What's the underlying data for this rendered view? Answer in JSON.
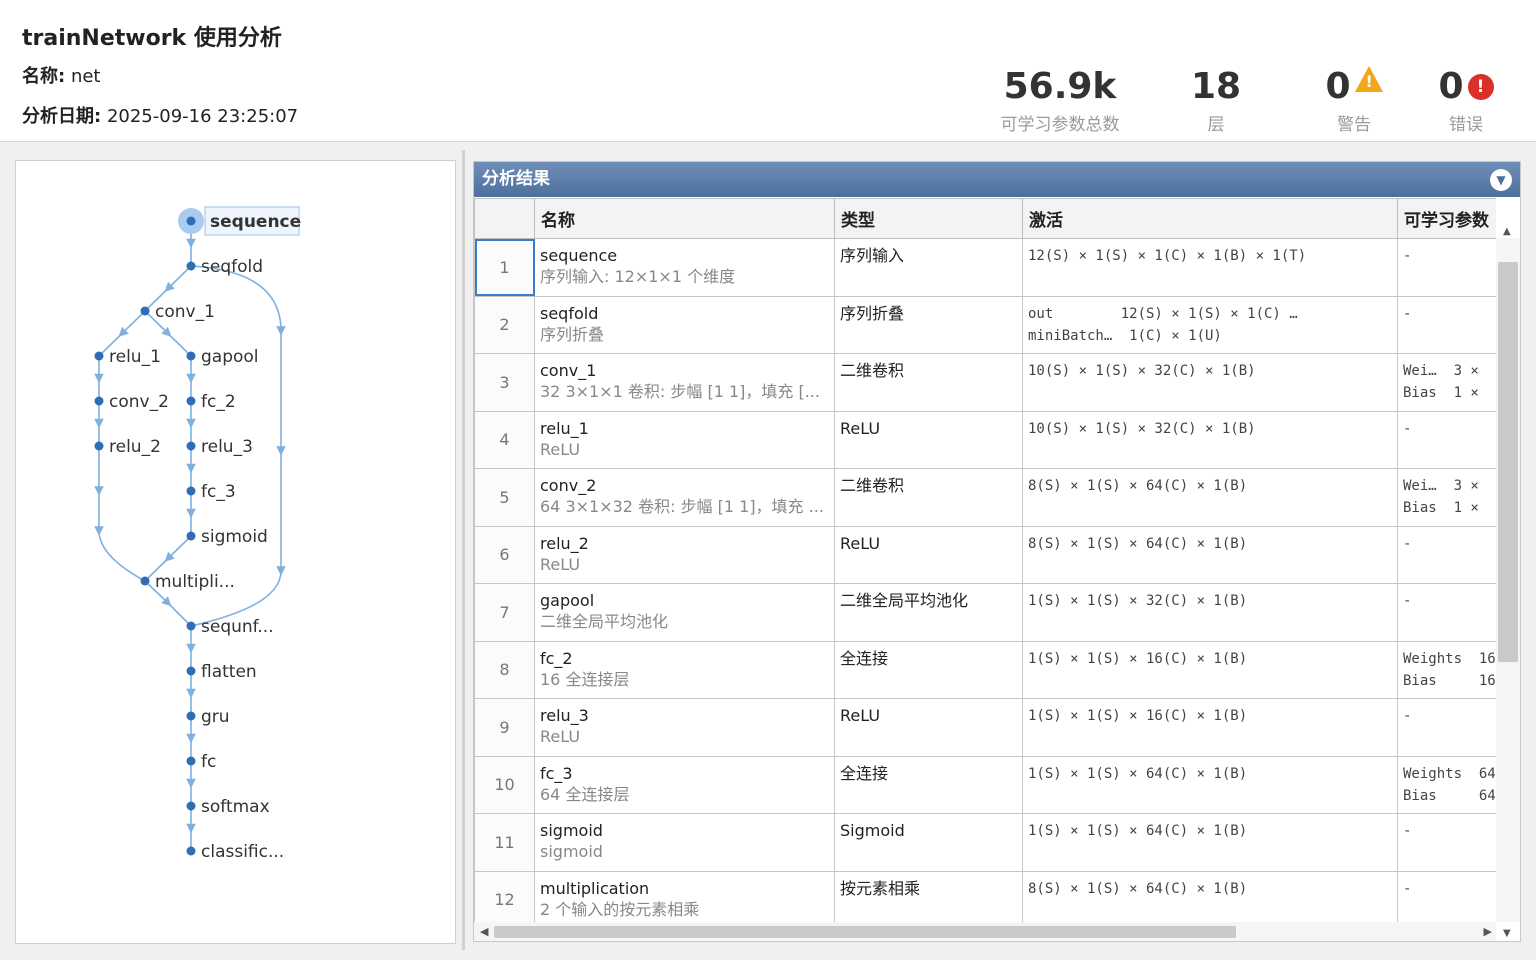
{
  "header": {
    "title": "trainNetwork 使用分析",
    "name_label": "名称:",
    "name_value": "net",
    "date_label": "分析日期:",
    "date_value": "2025-09-16 23:25:07"
  },
  "stats": {
    "params_value": "56.9k",
    "params_label": "可学习参数总数",
    "layers_value": "18",
    "layers_label": "层",
    "warnings_value": "0",
    "warnings_label": "警告",
    "errors_value": "0",
    "errors_label": "错误",
    "warning_icon": "warning-triangle-icon",
    "error_icon": "error-circle-icon"
  },
  "graph": {
    "nodes": [
      {
        "id": "sequence",
        "label": "sequence",
        "selected": true
      },
      {
        "id": "seqfold",
        "label": "seqfold"
      },
      {
        "id": "conv_1",
        "label": "conv_1"
      },
      {
        "id": "relu_1",
        "label": "relu_1"
      },
      {
        "id": "gapool",
        "label": "gapool"
      },
      {
        "id": "conv_2",
        "label": "conv_2"
      },
      {
        "id": "fc_2",
        "label": "fc_2"
      },
      {
        "id": "relu_2",
        "label": "relu_2"
      },
      {
        "id": "relu_3",
        "label": "relu_3"
      },
      {
        "id": "fc_3",
        "label": "fc_3"
      },
      {
        "id": "sigmoid",
        "label": "sigmoid"
      },
      {
        "id": "multiplication",
        "label": "multipli..."
      },
      {
        "id": "sequnfold",
        "label": "sequnf..."
      },
      {
        "id": "flatten",
        "label": "flatten"
      },
      {
        "id": "gru",
        "label": "gru"
      },
      {
        "id": "fc",
        "label": "fc"
      },
      {
        "id": "softmax",
        "label": "softmax"
      },
      {
        "id": "classification",
        "label": "classific..."
      }
    ]
  },
  "results": {
    "title": "分析结果",
    "columns": [
      "名称",
      "类型",
      "激活",
      "可学习参数"
    ],
    "rows": [
      {
        "idx": "1",
        "name": "sequence",
        "desc": "序列输入: 12×1×1 个维度",
        "type": "序列输入",
        "act1": "12(S) × 1(S) × 1(C) × 1(B) × 1(T)",
        "act2": "",
        "learn1": "-",
        "learn2": ""
      },
      {
        "idx": "2",
        "name": "seqfold",
        "desc": "序列折叠",
        "type": "序列折叠",
        "act1": "out        12(S) × 1(S) × 1(C) …",
        "act2": "miniBatch…  1(C) × 1(U)",
        "learn1": "-",
        "learn2": ""
      },
      {
        "idx": "3",
        "name": "conv_1",
        "desc": "32 3×1×1 卷积: 步幅 [1 1]，填充 [...",
        "type": "二维卷积",
        "act1": "10(S) × 1(S) × 32(C) × 1(B)",
        "act2": "",
        "learn1": "Wei…  3 ×",
        "learn2": "Bias  1 ×"
      },
      {
        "idx": "4",
        "name": "relu_1",
        "desc": "ReLU",
        "type": "ReLU",
        "act1": "10(S) × 1(S) × 32(C) × 1(B)",
        "act2": "",
        "learn1": "-",
        "learn2": ""
      },
      {
        "idx": "5",
        "name": "conv_2",
        "desc": "64 3×1×32 卷积: 步幅 [1 1]，填充 ...",
        "type": "二维卷积",
        "act1": "8(S) × 1(S) × 64(C) × 1(B)",
        "act2": "",
        "learn1": "Wei…  3 ×",
        "learn2": "Bias  1 ×"
      },
      {
        "idx": "6",
        "name": "relu_2",
        "desc": "ReLU",
        "type": "ReLU",
        "act1": "8(S) × 1(S) × 64(C) × 1(B)",
        "act2": "",
        "learn1": "-",
        "learn2": ""
      },
      {
        "idx": "7",
        "name": "gapool",
        "desc": "二维全局平均池化",
        "type": "二维全局平均池化",
        "act1": "1(S) × 1(S) × 32(C) × 1(B)",
        "act2": "",
        "learn1": "-",
        "learn2": ""
      },
      {
        "idx": "8",
        "name": "fc_2",
        "desc": "16 全连接层",
        "type": "全连接",
        "act1": "1(S) × 1(S) × 16(C) × 1(B)",
        "act2": "",
        "learn1": "Weights  16",
        "learn2": "Bias     16"
      },
      {
        "idx": "9",
        "name": "relu_3",
        "desc": "ReLU",
        "type": "ReLU",
        "act1": "1(S) × 1(S) × 16(C) × 1(B)",
        "act2": "",
        "learn1": "-",
        "learn2": ""
      },
      {
        "idx": "10",
        "name": "fc_3",
        "desc": "64 全连接层",
        "type": "全连接",
        "act1": "1(S) × 1(S) × 64(C) × 1(B)",
        "act2": "",
        "learn1": "Weights  64",
        "learn2": "Bias     64"
      },
      {
        "idx": "11",
        "name": "sigmoid",
        "desc": "sigmoid",
        "type": "Sigmoid",
        "act1": "1(S) × 1(S) × 64(C) × 1(B)",
        "act2": "",
        "learn1": "-",
        "learn2": ""
      },
      {
        "idx": "12",
        "name": "multiplication",
        "desc": "2 个输入的按元素相乘",
        "type": "按元素相乘",
        "act1": "8(S) × 1(S) × 64(C) × 1(B)",
        "act2": "",
        "learn1": "-",
        "learn2": ""
      }
    ]
  },
  "colors": {
    "title_bar": "#5a7aa6",
    "edge": "#7fb0de",
    "node": "#2f6db5",
    "selection": "#3b7dc8"
  }
}
